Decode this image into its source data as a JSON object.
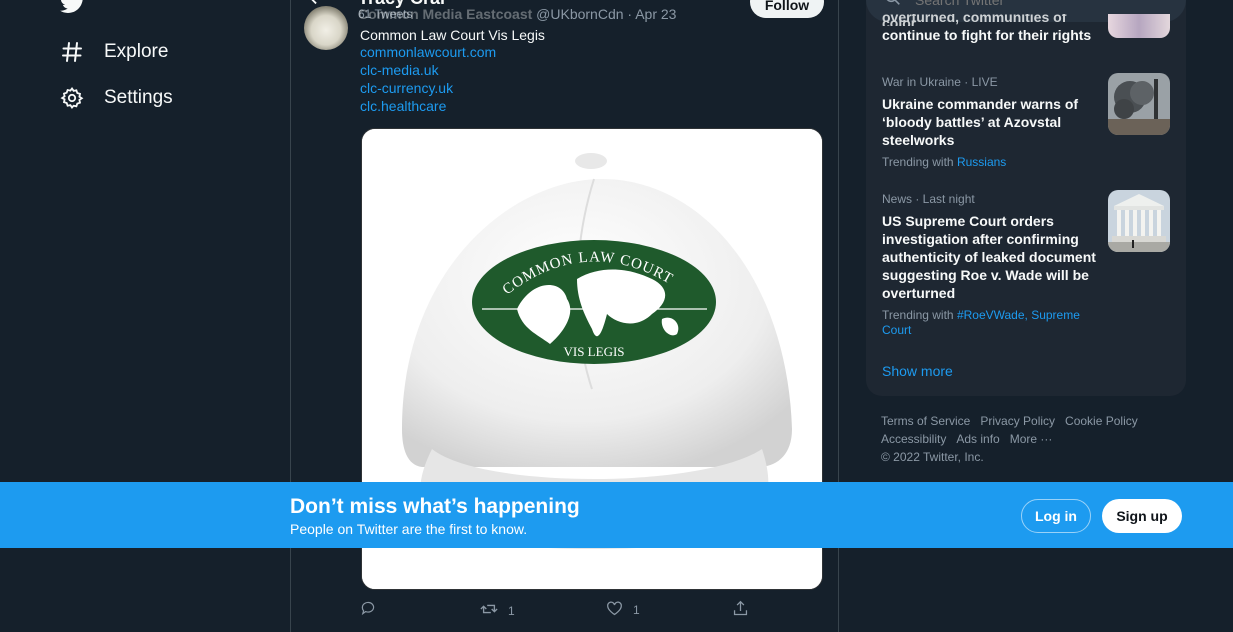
{
  "nav": {
    "explore_label": "Explore",
    "settings_label": "Settings"
  },
  "header": {
    "title": "Tracy Cral",
    "tweet_count": "61 Tweets",
    "follow_label": "Follow"
  },
  "tweet": {
    "author_name": "Common Media Eastcoast",
    "author_handle": "@UKbornCdn",
    "date": "Apr 23",
    "text": "Common Law Court Vis Legis",
    "links": [
      "commonlawcourt.com",
      "clc-media.uk",
      "clc-currency.uk",
      "clc.healthcare"
    ],
    "image_text_top": "COMMON LAW COURT",
    "image_text_bottom": "VIS LEGIS",
    "reply_count": "",
    "retweet_count": "1",
    "like_count": "1"
  },
  "search": {
    "placeholder": "Search Twitter"
  },
  "trends": {
    "partial_headline_top": "overturned, communities of color",
    "partial_headline": "continue to fight for their rights",
    "items": [
      {
        "meta": "War in Ukraine · LIVE",
        "headline": "Ukraine commander warns of ‘bloody battles’ at Azovstal steelworks",
        "trending_prefix": "Trending with",
        "trending_links": "Russians"
      },
      {
        "meta": "News · Last night",
        "headline": "US Supreme Court orders investigation after confirming authenticity of leaked document suggesting Roe v. Wade will be overturned",
        "trending_prefix": "Trending with",
        "trending_links": "#RoeVWade, Supreme Court"
      }
    ],
    "show_more": "Show more"
  },
  "footer": {
    "terms": "Terms of Service",
    "privacy": "Privacy Policy",
    "cookie": "Cookie Policy",
    "accessibility": "Accessibility",
    "ads": "Ads info",
    "more": "More ···",
    "copyright": "© 2022 Twitter, Inc."
  },
  "banner": {
    "title": "Don’t miss what’s happening",
    "subtitle": "People on Twitter are the first to know.",
    "login_label": "Log in",
    "signup_label": "Sign up"
  },
  "colors": {
    "background": "#15202b",
    "accent": "#1d9bf0",
    "panel": "#1e2732",
    "cap_green": "#1f5a2c"
  }
}
